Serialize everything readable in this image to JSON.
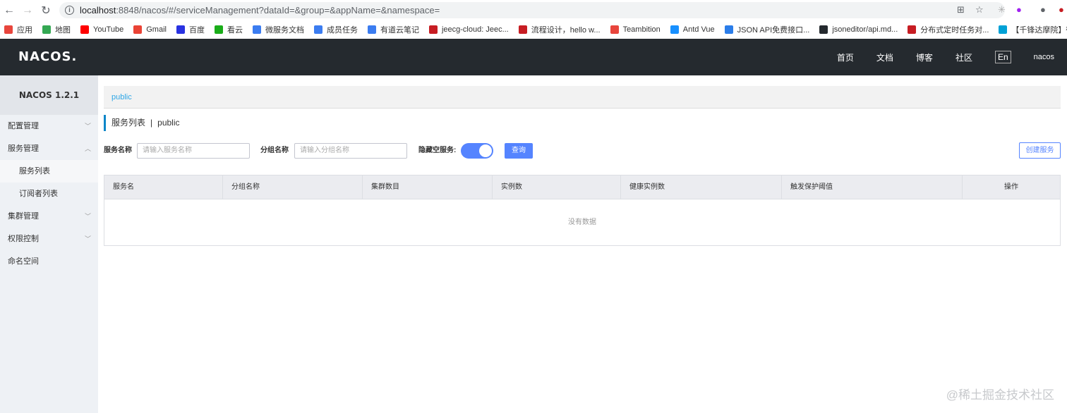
{
  "browser": {
    "url_host": "localhost",
    "url_rest": ":8848/nacos/#/serviceManagement?dataId=&group=&appName=&namespace=",
    "bookmarks": [
      {
        "label": "应用",
        "icon": "apps-grid-icon",
        "color": "#e8453c"
      },
      {
        "label": "地图",
        "icon": "maps-icon",
        "color": "#34a853"
      },
      {
        "label": "YouTube",
        "icon": "youtube-icon",
        "color": "#ff0000"
      },
      {
        "label": "Gmail",
        "icon": "gmail-icon",
        "color": "#ea4335"
      },
      {
        "label": "百度",
        "icon": "baidu-icon",
        "color": "#2932e1"
      },
      {
        "label": "看云",
        "icon": "kancloud-icon",
        "color": "#1aad19"
      },
      {
        "label": "微服务文档",
        "icon": "doc-icon",
        "color": "#3b7cf0"
      },
      {
        "label": "成员任务",
        "icon": "doc-icon",
        "color": "#3b7cf0"
      },
      {
        "label": "有道云笔记",
        "icon": "youdao-icon",
        "color": "#3b7cf0"
      },
      {
        "label": "jeecg-cloud: Jeec...",
        "icon": "gitee-icon",
        "color": "#c71d23"
      },
      {
        "label": "流程设计，hello w...",
        "icon": "flow-icon",
        "color": "#c71d23"
      },
      {
        "label": "Teambition",
        "icon": "teambition-icon",
        "color": "#e8453c"
      },
      {
        "label": "Antd Vue",
        "icon": "antd-icon",
        "color": "#1890ff"
      },
      {
        "label": "JSON API免费接口...",
        "icon": "json-icon",
        "color": "#2b7de9"
      },
      {
        "label": "jsoneditor/api.md...",
        "icon": "github-icon",
        "color": "#24292e"
      },
      {
        "label": "分布式定时任务对...",
        "icon": "csdn-icon",
        "color": "#c71d23"
      },
      {
        "label": "【千锋达摩院】微...",
        "icon": "bilibili-icon",
        "color": "#00a1d6"
      }
    ]
  },
  "header": {
    "logo": "NACOS.",
    "nav": [
      "首页",
      "文档",
      "博客",
      "社区"
    ],
    "lang": "En",
    "user": "nacos"
  },
  "sidebar": {
    "version": "NACOS 1.2.1",
    "items": [
      {
        "label": "配置管理",
        "chevron": "down"
      },
      {
        "label": "服务管理",
        "chevron": "up"
      },
      {
        "label": "服务列表",
        "sub": true,
        "active": true
      },
      {
        "label": "订阅者列表",
        "sub": true
      },
      {
        "label": "集群管理",
        "chevron": "down"
      },
      {
        "label": "权限控制",
        "chevron": "down"
      },
      {
        "label": "命名空间"
      }
    ]
  },
  "main": {
    "breadcrumb": "public",
    "title": "服务列表",
    "title_sep": "|",
    "namespace": "public",
    "filter": {
      "service_label": "服务名称",
      "service_placeholder": "请输入服务名称",
      "group_label": "分组名称",
      "group_placeholder": "请输入分组名称",
      "hide_empty_label": "隐藏空服务:",
      "hide_empty_on": true,
      "query_button": "查询",
      "create_button": "创建服务"
    },
    "table": {
      "columns": [
        "服务名",
        "分组名称",
        "集群数目",
        "实例数",
        "健康实例数",
        "触发保护阈值",
        "操作"
      ],
      "empty_text": "没有数据"
    }
  },
  "watermark": "@稀土掘金技术社区"
}
